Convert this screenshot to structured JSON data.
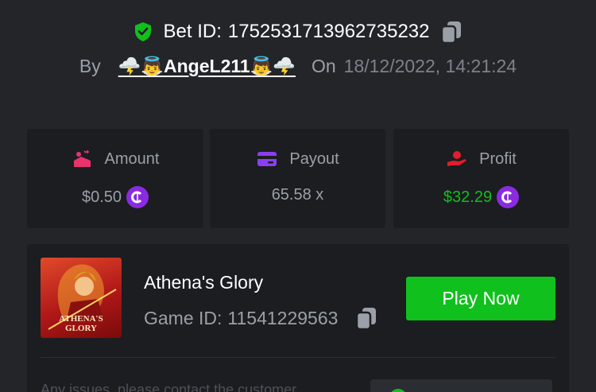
{
  "bet": {
    "label": "Bet ID:",
    "id": "1752531713962735232"
  },
  "meta": {
    "by_label": "By",
    "user": "🌩️👼AngeL211👼🌩️",
    "on_label": "On",
    "date": "18/12/2022, 14:21:24"
  },
  "stats": {
    "amount": {
      "label": "Amount",
      "value": "$0.50"
    },
    "payout": {
      "label": "Payout",
      "value": "65.58 x"
    },
    "profit": {
      "label": "Profit",
      "value": "$32.29"
    }
  },
  "game": {
    "title": "Athena's Glory",
    "id_label": "Game ID:",
    "id": "11541229563",
    "thumb_text_line1": "ATHENA'S",
    "thumb_text_line2": "GLORY",
    "play_label": "Play Now"
  },
  "support": {
    "text": "Any issues, please contact the customer"
  },
  "colors": {
    "background": "#232529",
    "card": "#1b1d20",
    "accent_green": "#10c01c",
    "coin_purple": "#8a2be2",
    "amount_icon": "#e8336d",
    "payout_icon": "#8c3ef0",
    "profit_icon": "#e01e2e",
    "shield": "#10c01c"
  }
}
